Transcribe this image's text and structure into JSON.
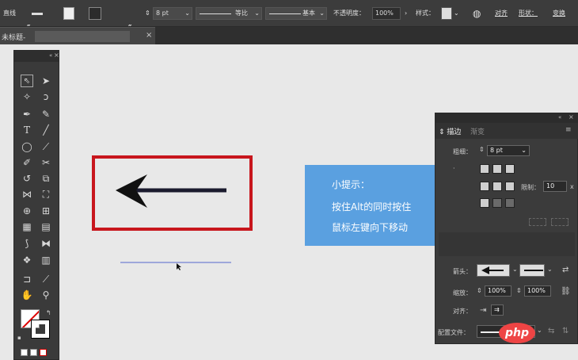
{
  "control_bar": {
    "tool_name": "直线",
    "stroke_weight": "8 pt",
    "profile_label": "等比",
    "brush_label": "基本",
    "opacity_label": "不透明度：",
    "opacity_value": "100%",
    "style_label": "样式：",
    "align_label": "对齐",
    "shape_label": "形状：",
    "transform_label": "变换"
  },
  "document_tab": {
    "title": "未标题-",
    "close": "×"
  },
  "tools": {
    "text_tool": "T"
  },
  "hint_box": {
    "title": "小提示：",
    "line1": "按住Alt的同时按住",
    "line2": "鼠标左键向下移动",
    "color": "#5aa0e0"
  },
  "stroke_panel": {
    "tab_stroke": "描边",
    "tab_gradient": "渐变",
    "weight_label": "粗细：",
    "weight_value": "8 pt",
    "limit_label": "限制：",
    "limit_value": "10",
    "limit_suffix": "x",
    "arrowhead_label": "箭头：",
    "scale_label": "缩放：",
    "scale_start": "100%",
    "scale_end": "100%",
    "align_label": "对齐：",
    "profile_label": "配置文件："
  },
  "watermark": "php",
  "accent_colors": {
    "highlight_frame": "#c8161d",
    "guide_line": "#5566cc"
  }
}
